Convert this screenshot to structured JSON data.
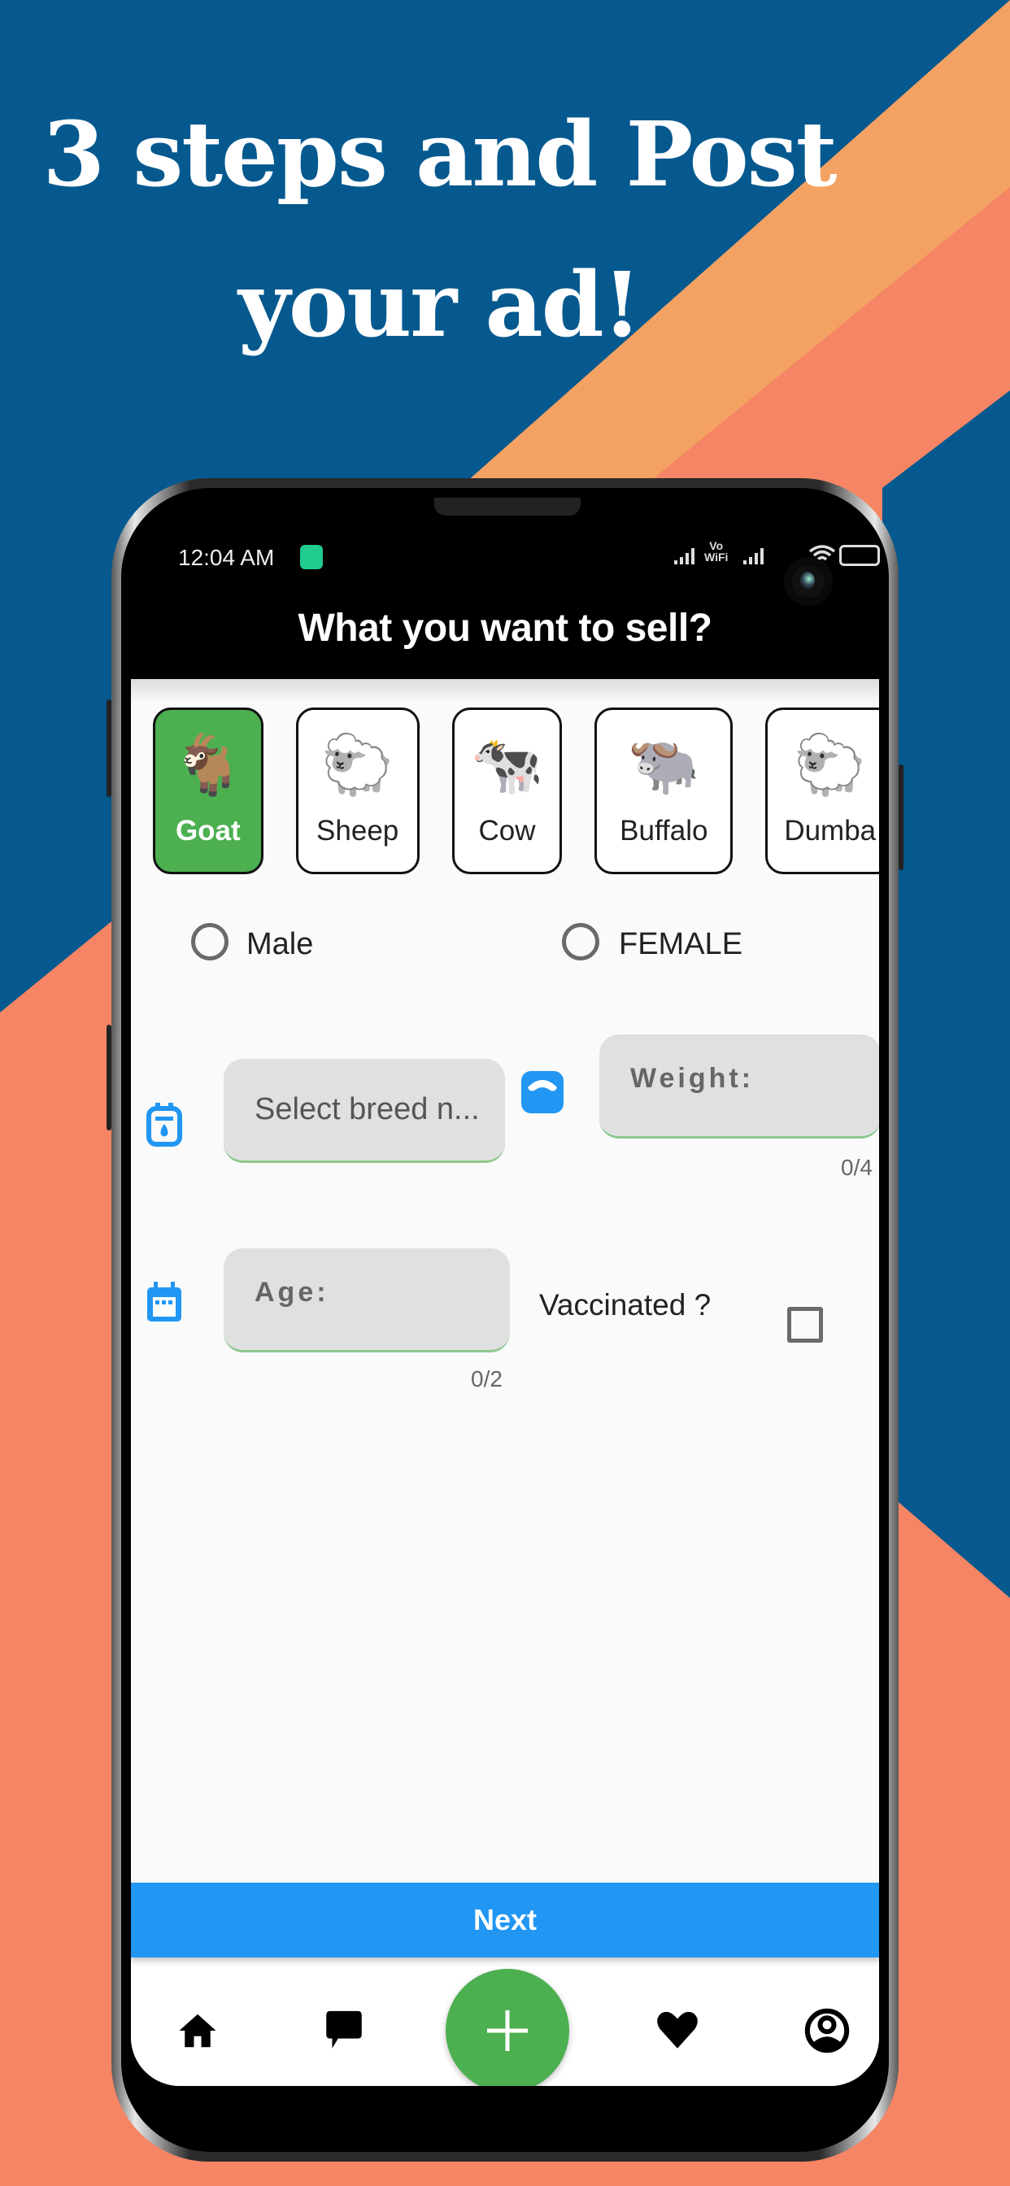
{
  "promo": {
    "headline_line1": "3 steps and Post",
    "headline_line2": "your ad!",
    "colors": {
      "blue": "#05598f",
      "orange": "#f4a263",
      "salmon": "#f58564"
    }
  },
  "statusbar": {
    "time": "12:04 AM",
    "vowifi_top": "Vo",
    "vowifi_bottom": "WiFi"
  },
  "appbar": {
    "title": "What you want to sell?"
  },
  "animals": [
    {
      "label": "Goat",
      "icon": "goat-icon",
      "glyph": "🐐",
      "selected": true
    },
    {
      "label": "Sheep",
      "icon": "sheep-icon",
      "glyph": "🐑",
      "selected": false
    },
    {
      "label": "Cow",
      "icon": "cow-icon",
      "glyph": "🐄",
      "selected": false
    },
    {
      "label": "Buffalo",
      "icon": "buffalo-icon",
      "glyph": "🐃",
      "selected": false
    },
    {
      "label": "Dumba",
      "icon": "dumba-icon",
      "glyph": "🐑",
      "selected": false
    }
  ],
  "gender": {
    "male_label": "Male",
    "female_label": "FEMALE",
    "selected": null
  },
  "form": {
    "breed_placeholder": "Select breed n...",
    "weight_label": "Weight:",
    "weight_counter": "0/4",
    "age_label": "Age:",
    "age_counter": "0/2",
    "vaccinated_label": "Vaccinated ?",
    "vaccinated_checked": false
  },
  "actions": {
    "next_label": "Next"
  },
  "bottom_nav": {
    "items": [
      "home-icon",
      "chat-icon",
      "add-icon",
      "favorite-icon",
      "profile-icon"
    ]
  },
  "accent": {
    "green": "#4caf50",
    "blue": "#2196f3"
  }
}
